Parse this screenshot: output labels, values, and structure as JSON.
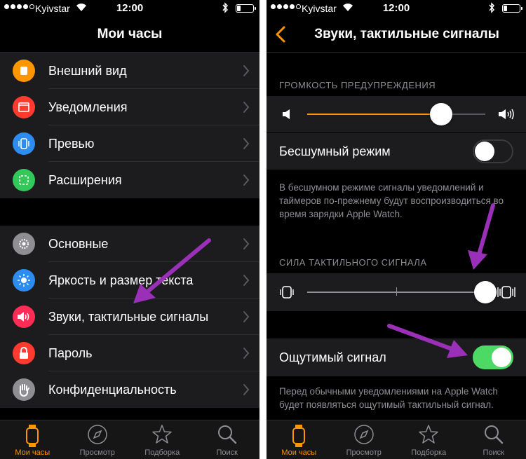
{
  "status_bar": {
    "carrier": "Kyivstar",
    "time": "12:00"
  },
  "left_screen": {
    "title": "Мои часы",
    "group1": [
      {
        "label": "Внешний вид",
        "color": "#ff9500",
        "icon": "watch-face-icon"
      },
      {
        "label": "Уведомления",
        "color": "#ff3b30",
        "icon": "notifications-icon"
      },
      {
        "label": "Превью",
        "color": "#2d8cf0",
        "icon": "glance-icon"
      },
      {
        "label": "Расширения",
        "color": "#34c759",
        "icon": "complications-icon"
      }
    ],
    "group2": [
      {
        "label": "Основные",
        "color": "#8e8e93",
        "icon": "gear-icon"
      },
      {
        "label": "Яркость и размер текста",
        "color": "#2d8cf0",
        "icon": "brightness-icon"
      },
      {
        "label": "Звуки, тактильные сигналы",
        "color": "#ff2d55",
        "icon": "speaker-icon"
      },
      {
        "label": "Пароль",
        "color": "#ff3b30",
        "icon": "lock-icon"
      },
      {
        "label": "Конфиденциальность",
        "color": "#8e8e93",
        "icon": "hand-icon"
      }
    ]
  },
  "right_screen": {
    "title": "Звуки, тактильные сигналы",
    "alert_volume_header": "ГРОМКОСТЬ ПРЕДУПРЕЖДЕНИЯ",
    "alert_volume_level": 0.75,
    "silent_mode_label": "Бесшумный режим",
    "silent_mode_on": false,
    "silent_mode_note": "В бесшумном режиме сигналы уведомлений и таймеров по-прежнему будут воспроизводиться во время зарядки Apple Watch.",
    "haptic_header": "СИЛА ТАКТИЛЬНОГО СИГНАЛА",
    "haptic_level": 1.0,
    "prominent_haptic_label": "Ощутимый сигнал",
    "prominent_haptic_on": true,
    "prominent_haptic_note": "Перед обычными уведомлениями на Apple Watch будет появляться ощутимый тактильный сигнал."
  },
  "tab_bar": {
    "tabs": [
      "Мои часы",
      "Просмотр",
      "Подборка",
      "Поиск"
    ],
    "active": 0
  },
  "colors": {
    "accent": "#ff9500",
    "toggle_on": "#4cd964",
    "annotation_arrow": "#9b30b8"
  }
}
